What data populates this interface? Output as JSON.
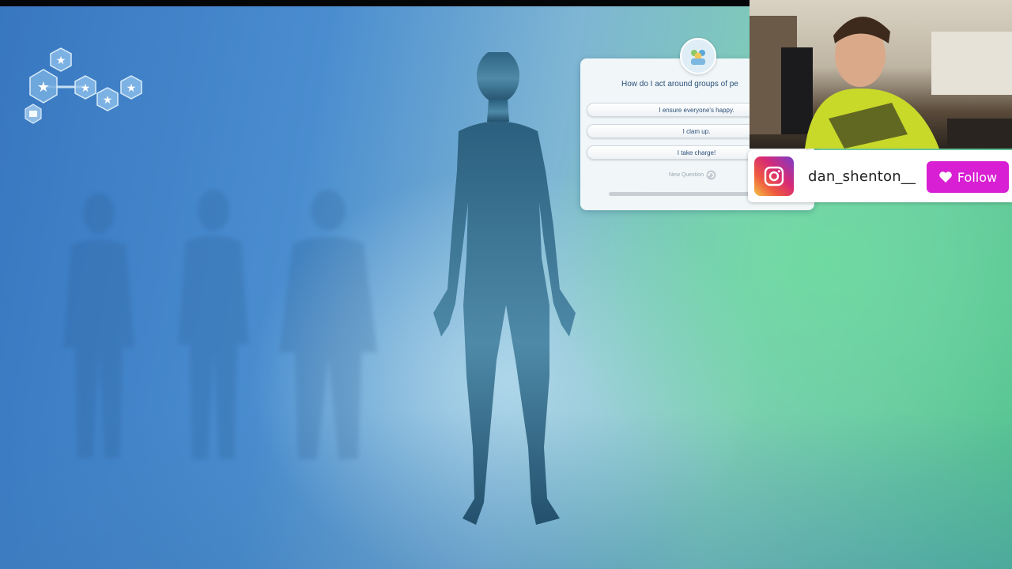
{
  "question": {
    "text": "How do I act around groups of pe",
    "answers": [
      {
        "label": "I ensure everyone's happy."
      },
      {
        "label": "I clam up."
      },
      {
        "label": "I take charge!"
      }
    ],
    "new_question_label": "New Question",
    "progress": 0.0
  },
  "icons": {
    "aspiration": "aspiration-hex-icon",
    "avatar": "group-avatar-icon",
    "refresh": "refresh-icon",
    "instagram": "instagram-icon",
    "heart": "heart-icon"
  },
  "overlay": {
    "instagram_handle": "dan_shenton__",
    "follow_label": "Follow"
  },
  "colors": {
    "follow": "#d81fd3",
    "panel_text": "#2a4f78"
  }
}
